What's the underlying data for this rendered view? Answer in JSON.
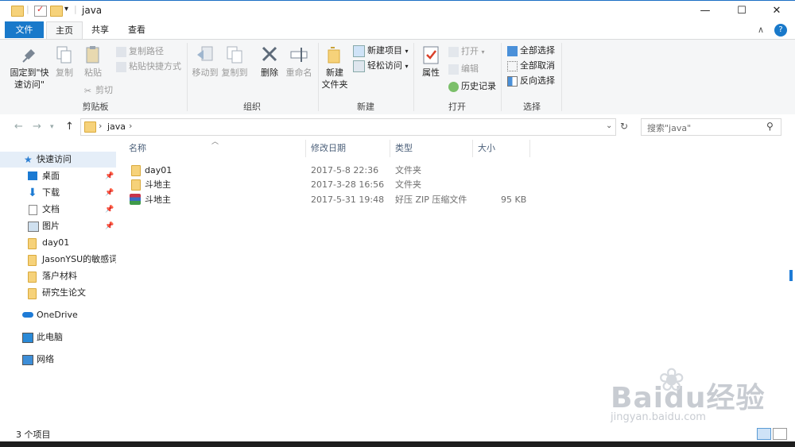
{
  "window": {
    "title": "java",
    "min": "—",
    "max": "☐",
    "close": "✕"
  },
  "tabs": {
    "file": "文件",
    "home": "主页",
    "share": "共享",
    "view": "查看",
    "collapse": "∧",
    "help": "?"
  },
  "ribbon": {
    "clipboard": {
      "pin": "固定到\"快",
      "pin2": "速访问\"",
      "copy": "复制",
      "paste": "粘贴",
      "copy_path": "复制路径",
      "paste_shortcut": "粘贴快捷方式",
      "cut": "剪切",
      "label": "剪贴板"
    },
    "organize": {
      "move_to": "移动到",
      "copy_to": "复制到",
      "delete": "删除",
      "rename": "重命名",
      "label": "组织"
    },
    "new": {
      "new_folder": "新建",
      "new_folder2": "文件夹",
      "new_item": "新建项目",
      "easy_access": "轻松访问",
      "label": "新建"
    },
    "open": {
      "properties": "属性",
      "open": "打开",
      "edit": "编辑",
      "history": "历史记录",
      "label": "打开"
    },
    "select": {
      "select_all": "全部选择",
      "select_none": "全部取消",
      "invert": "反向选择",
      "label": "选择"
    }
  },
  "address": {
    "crumb": "java",
    "search_placeholder": "搜索\"java\""
  },
  "nav": {
    "quick_access": "快速访问",
    "items": [
      {
        "label": "桌面",
        "pinned": true
      },
      {
        "label": "下载",
        "pinned": true
      },
      {
        "label": "文档",
        "pinned": true
      },
      {
        "label": "图片",
        "pinned": true
      },
      {
        "label": "day01",
        "pinned": false
      },
      {
        "label": "JasonYSU的敏感词",
        "pinned": false
      },
      {
        "label": "落户材料",
        "pinned": false
      },
      {
        "label": "研究生论文",
        "pinned": false
      }
    ],
    "onedrive": "OneDrive",
    "this_pc": "此电脑",
    "network": "网络"
  },
  "columns": {
    "name": "名称",
    "modified": "修改日期",
    "type": "类型",
    "size": "大小"
  },
  "files": [
    {
      "name": "day01",
      "modified": "2017-5-8 22:36",
      "type": "文件夹",
      "size": "",
      "icon": "folder-icon"
    },
    {
      "name": "斗地主",
      "modified": "2017-3-28 16:56",
      "type": "文件夹",
      "size": "",
      "icon": "folder-icon"
    },
    {
      "name": "斗地主",
      "modified": "2017-5-31 19:48",
      "type": "好压 ZIP 压缩文件",
      "size": "95 KB",
      "icon": "zip-archive-icon"
    }
  ],
  "status": {
    "count": "3 个项目"
  },
  "watermark": {
    "brand": "Baidu经验",
    "url": "jingyan.baidu.com"
  }
}
